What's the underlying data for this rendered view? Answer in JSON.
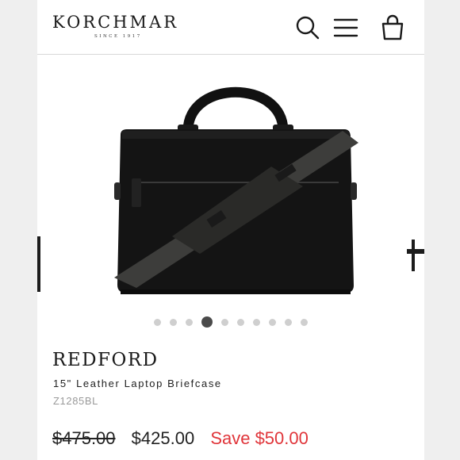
{
  "brand": {
    "name": "KORCHMAR",
    "tagline": "SINCE 1917"
  },
  "header": {
    "icons": [
      "search-icon",
      "menu-icon",
      "cart-bag-icon"
    ]
  },
  "gallery": {
    "image": "black-leather-briefcase-image",
    "dot_count": 10,
    "active_index": 3
  },
  "product": {
    "name": "REDFORD",
    "subtitle": "15\" Leather Laptop Briefcase",
    "sku": "Z1285BL",
    "price_original": "$475.00",
    "price_sale": "$425.00",
    "savings": "Save $50.00"
  },
  "colors": {
    "sale_red": "#e0353a",
    "text_dark": "#222222",
    "text_muted": "#9a9a9a"
  }
}
